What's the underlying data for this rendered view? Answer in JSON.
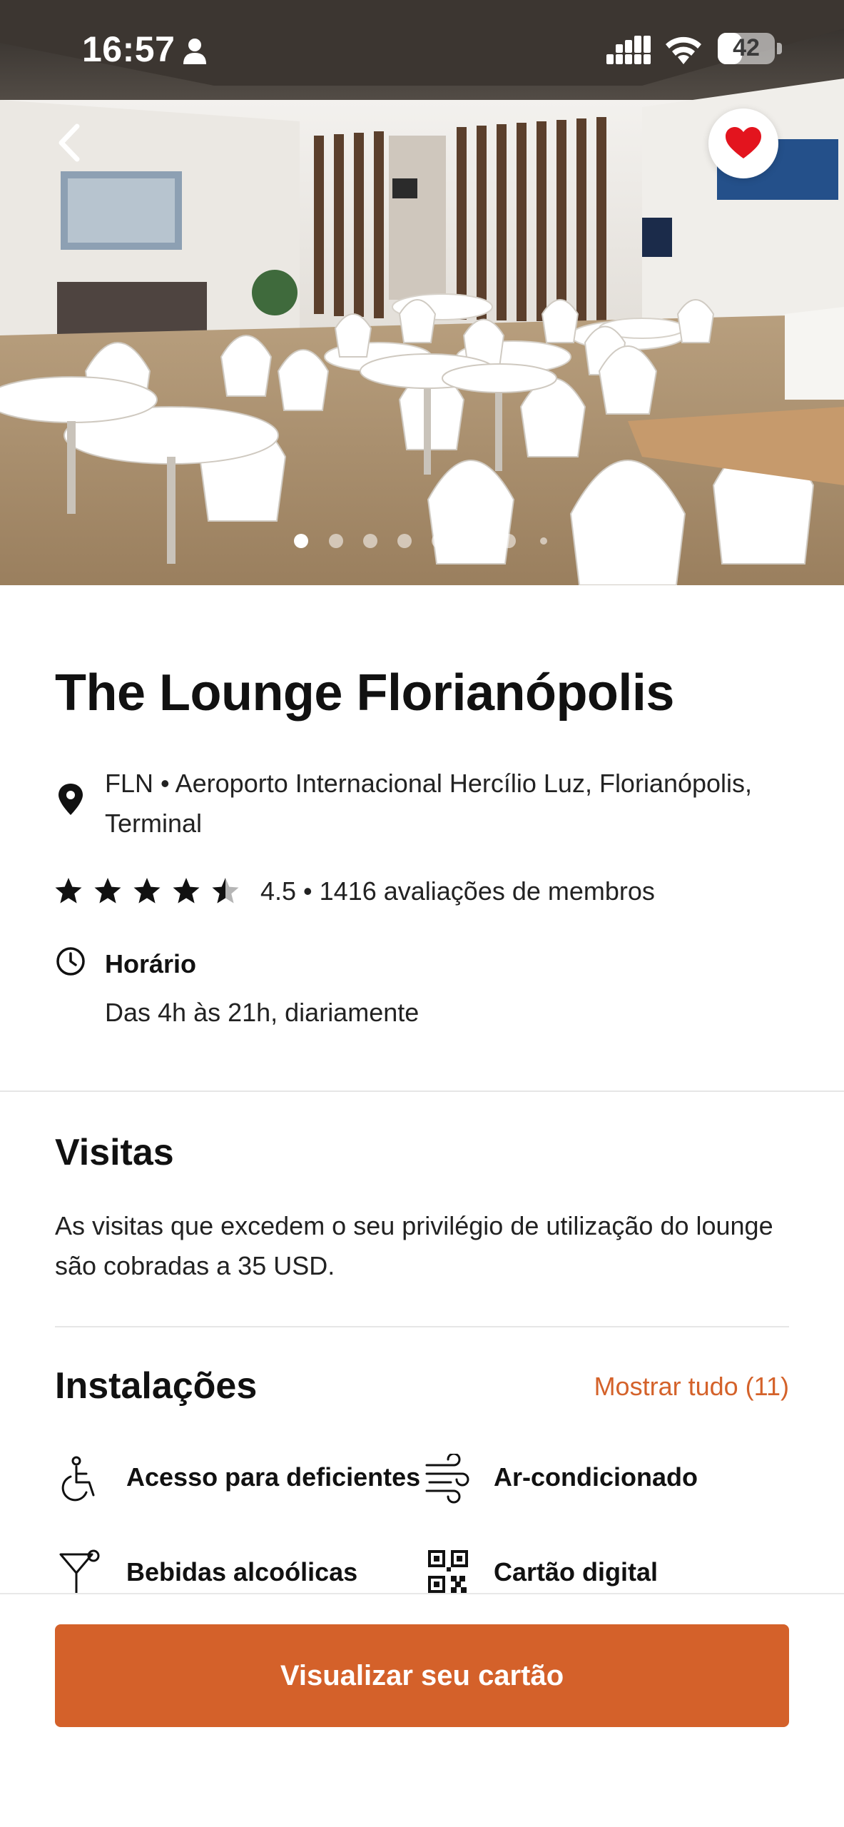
{
  "status_bar": {
    "time": "16:57",
    "battery": "42",
    "battery_level": 0.42
  },
  "hero": {
    "page_count": 8,
    "active_page": 1,
    "favorited": true
  },
  "lounge": {
    "title": "The Lounge Florianópolis",
    "location": "FLN • Aeroporto Internacional Hercílio Luz, Florianópolis, Terminal",
    "rating": 4.5,
    "rating_text": "4.5 • 1416 avaliações de membros",
    "hours_label": "Horário",
    "hours_text": "Das 4h às 21h, diariamente"
  },
  "visits": {
    "heading": "Visitas",
    "text": "As visitas que excedem o seu privilégio de utilização do lounge são cobradas a 35 USD."
  },
  "facilities": {
    "heading": "Instalações",
    "show_all": "Mostrar tudo (11)",
    "items": [
      {
        "label": "Acesso para deficientes",
        "icon": "wheelchair-icon"
      },
      {
        "label": "Ar-condicionado",
        "icon": "air-conditioning-icon"
      },
      {
        "label": "Bebidas alcoólicas",
        "icon": "cocktail-icon"
      },
      {
        "label": "Cartão digital",
        "icon": "qr-code-icon"
      }
    ]
  },
  "cta": {
    "label": "Visualizar seu cartão"
  },
  "colors": {
    "accent": "#d4612a",
    "favorite": "#e3141e"
  }
}
